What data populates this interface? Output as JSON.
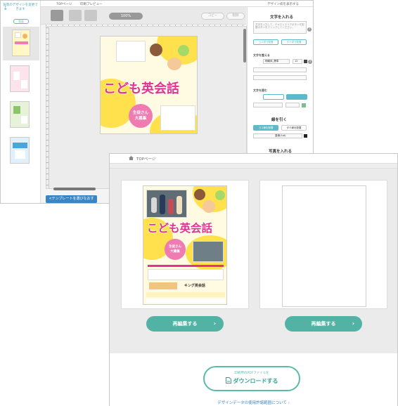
{
  "editor": {
    "left_panel": {
      "hint": "背景のデザインを変更できます",
      "tab_label": "背面"
    },
    "top_bar": {
      "home": "TOPページ",
      "print_preview": "印刷プレビュー",
      "show_design_guide": "デザイン枠を表示する"
    },
    "toolbar": {
      "zoom": "100%",
      "copy": "コピー",
      "delete": "削除"
    },
    "template_button": "<テンプレートを選びなおす",
    "right_panel": {
      "section_text": "文字を入れる",
      "textarea_placeholder": "文字を入力して、テキストエリアボタンを配置ボタンをクリックしてください。",
      "btn_add_horizontal": "ヨコ書き配置",
      "btn_add_vertical": "タテ書き配置",
      "section_font": "文字を整える",
      "font_name": "明朝体_標準",
      "font_size": "12",
      "section_outline": "文字を囲む",
      "section_line": "線を引く",
      "btn_line_h": "ヨコ線を配置",
      "btn_line_v": "タテ線を配置",
      "line_style": "直線(1pt)",
      "section_photo": "写真を入れる"
    }
  },
  "poster": {
    "title": "こども英会話",
    "badge_line1": "生徒さん",
    "badge_line2": "大募集",
    "school_name": "キング英会話"
  },
  "front": {
    "breadcrumb": "TOPページ",
    "btn_reedit_left": "再編集する",
    "btn_reedit_right": "再編集する",
    "download_small": "印刷用のPDFファイルを",
    "download_big": "ダウンロードする",
    "terms_link": "デザインデータの使用許諾範囲について"
  },
  "colors": {
    "teal": "#52b3a5",
    "blue": "#3a86c5",
    "pink_title": "#e2348e",
    "poster_yellow": "#ffe14d"
  }
}
